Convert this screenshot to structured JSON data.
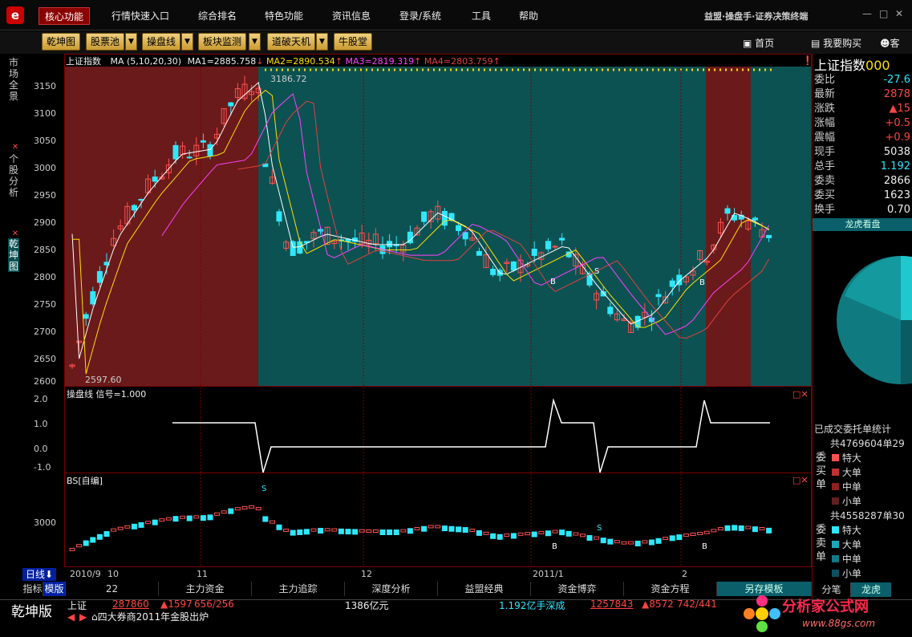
{
  "menubar": {
    "items": [
      "核心功能",
      "行情快速入口",
      "综合排名",
      "特色功能",
      "资讯信息",
      "登录/系统",
      "工具",
      "帮助"
    ],
    "brand": "益盟·操盘手·证券决策终端",
    "win_min": "—",
    "win_max": "□",
    "win_close": "✕"
  },
  "toolbar": {
    "buttons": [
      "乾坤图",
      "股票池",
      "操盘线",
      "板块监测",
      "道破天机",
      "牛股堂"
    ],
    "home": "首页",
    "buy": "我要购买",
    "service": "客"
  },
  "leftbar": {
    "tab1": "市场全景",
    "tab2": "个股分析",
    "tab3": "乾坤图"
  },
  "main": {
    "ma_name": "上证指数",
    "ma_label": "MA (5,10,20,30)",
    "ma1": "MA1=2885.758",
    "ma2": "MA2=2890.534",
    "ma3": "MA3=2819.319",
    "ma4": "MA4=2803.759",
    "high_label": "3186.72",
    "low_label": "2597.60",
    "yticks": [
      "3150",
      "3100",
      "3050",
      "3000",
      "2950",
      "2900",
      "2850",
      "2800",
      "2750",
      "2700",
      "2650",
      "2600"
    ],
    "b_label": "B",
    "s_label": "S"
  },
  "caopan": {
    "title": "操盘线 信号=1.000",
    "yticks": [
      "2.0",
      "1.0",
      "0.0",
      "-1.0"
    ]
  },
  "bs": {
    "title": "BS[自编]",
    "ytick": "3000"
  },
  "xaxis": {
    "period": "日线",
    "labels": [
      "2010/9",
      "10",
      "11",
      "12",
      "2011/1",
      "2"
    ]
  },
  "bottom_tabs": {
    "left1": "指标",
    "left2": "模版",
    "tabs": [
      "22",
      "主力资金",
      "主力追踪",
      "深度分析",
      "益盟经典",
      "资金博弈",
      "资金方程",
      "另存模板"
    ]
  },
  "right": {
    "title": "上证指数",
    "code": "000",
    "rows": [
      {
        "label": "委比",
        "value": "-27.6"
      },
      {
        "label": "最新",
        "value": "2878"
      },
      {
        "label": "涨跌",
        "value": "▲15"
      },
      {
        "label": "涨幅",
        "value": "+0.5"
      },
      {
        "label": "震幅",
        "value": "+0.9"
      },
      {
        "label": "现手",
        "value": "5038"
      },
      {
        "label": "总手",
        "value": "1.192"
      },
      {
        "label": "委卖",
        "value": "2866"
      },
      {
        "label": "委买",
        "value": "1623"
      },
      {
        "label": "换手",
        "value": "0.70"
      }
    ],
    "lhkp": "龙虎看盘",
    "stat_title": "已成交委托单统计",
    "buy_total": "共4769604单29",
    "buy_label": "委买单",
    "sell_total": "共4558287单30",
    "sell_label": "委卖单",
    "sizes": [
      "特大",
      "大单",
      "中单",
      "小单"
    ],
    "tab_fen": "分笔",
    "tab_lh": "龙虎"
  },
  "status": {
    "edition": "乾坤版",
    "sh": "上证",
    "sh_price": "287860",
    "sh_chg": "▲1597",
    "sh_ud": "656/256",
    "sh_amount": "1386亿元",
    "sz_amount": "1.192亿手深成",
    "sz_price": "1257843",
    "sz_chg": "▲8572",
    "sz_ud": "742/441",
    "news": "四大券商2011年金股出炉",
    "watermark": "分析家公式网",
    "url": "www.88gs.com"
  }
}
